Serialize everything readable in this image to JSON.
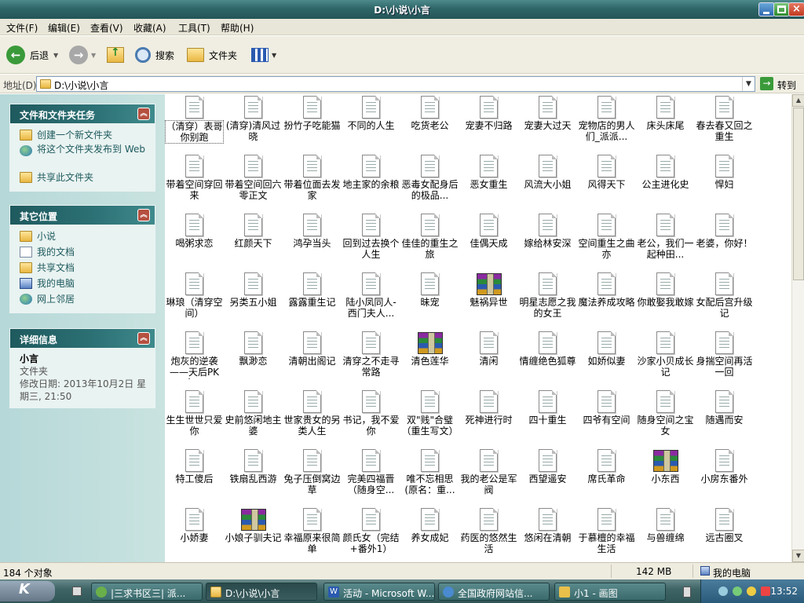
{
  "window": {
    "title": "D:\\小说\\小言"
  },
  "menu": [
    "文件(F)",
    "编辑(E)",
    "查看(V)",
    "收藏(A)",
    "工具(T)",
    "帮助(H)"
  ],
  "toolbar": {
    "back": "后退",
    "search": "搜索",
    "folders": "文件夹"
  },
  "address": {
    "label": "地址(D)",
    "value": "D:\\小说\\小言",
    "go": "转到"
  },
  "panels": {
    "tasks": {
      "title": "文件和文件夹任务",
      "items": [
        "创建一个新文件夹",
        "将这个文件夹发布到 Web",
        "共享此文件夹"
      ]
    },
    "places": {
      "title": "其它位置",
      "items": [
        "小说",
        "我的文档",
        "共享文档",
        "我的电脑",
        "网上邻居"
      ]
    },
    "details": {
      "title": "详细信息",
      "name": "小言",
      "type": "文件夹",
      "modified": "修改日期: 2013年10月2日 星期三, 21:50"
    }
  },
  "files": [
    {
      "name": "（清穿）表哥你别跑",
      "type": "txt"
    },
    {
      "name": "(清穿)清风过晓",
      "type": "txt"
    },
    {
      "name": "扮竹子吃能猫",
      "type": "txt"
    },
    {
      "name": "不同的人生",
      "type": "txt"
    },
    {
      "name": "吃货老公",
      "type": "txt"
    },
    {
      "name": "宠妻不归路",
      "type": "txt"
    },
    {
      "name": "宠妻大过天",
      "type": "txt"
    },
    {
      "name": "宠物店的男人们_派派...",
      "type": "txt"
    },
    {
      "name": "床头床尾",
      "type": "txt"
    },
    {
      "name": "春去春又回之重生",
      "type": "txt"
    },
    {
      "name": "带着空间穿回来",
      "type": "txt"
    },
    {
      "name": "带着空间回六零正文",
      "type": "txt"
    },
    {
      "name": "带着位面去发家",
      "type": "txt"
    },
    {
      "name": "地主家的余粮",
      "type": "txt"
    },
    {
      "name": "恶毒女配身后的极品...",
      "type": "txt"
    },
    {
      "name": "恶女重生",
      "type": "txt"
    },
    {
      "name": "风流大小姐",
      "type": "txt"
    },
    {
      "name": "风得天下",
      "type": "txt"
    },
    {
      "name": "公主进化史",
      "type": "txt"
    },
    {
      "name": "悍妇",
      "type": "txt"
    },
    {
      "name": "喝粥求恋",
      "type": "txt"
    },
    {
      "name": "红颜天下",
      "type": "txt"
    },
    {
      "name": "鸿孕当头",
      "type": "txt"
    },
    {
      "name": "回到过去换个人生",
      "type": "txt"
    },
    {
      "name": "佳佳的重生之旅",
      "type": "txt"
    },
    {
      "name": "佳偶天成",
      "type": "txt"
    },
    {
      "name": "嫁给林安深",
      "type": "txt"
    },
    {
      "name": "空间重生之曲亦",
      "type": "txt"
    },
    {
      "name": "老公，我们一起种田...",
      "type": "txt"
    },
    {
      "name": "老婆，你好！",
      "type": "txt"
    },
    {
      "name": "琳琅（清穿空间）",
      "type": "txt"
    },
    {
      "name": "另类五小姐",
      "type": "txt"
    },
    {
      "name": "露露重生记",
      "type": "txt"
    },
    {
      "name": "陆小凤同人-西门夫人...",
      "type": "txt"
    },
    {
      "name": "昧宠",
      "type": "txt"
    },
    {
      "name": "魅祸异世",
      "type": "rar"
    },
    {
      "name": "明星志愿之我的女王",
      "type": "txt"
    },
    {
      "name": "魔法养成攻略",
      "type": "txt"
    },
    {
      "name": "你敢娶我敢嫁",
      "type": "txt"
    },
    {
      "name": "女配后宫升级记",
      "type": "txt"
    },
    {
      "name": "炮灰的逆袭——天后PK女...",
      "type": "txt"
    },
    {
      "name": "飘渺恋",
      "type": "txt"
    },
    {
      "name": "清朝出阁记",
      "type": "txt"
    },
    {
      "name": "清穿之不走寻常路",
      "type": "txt"
    },
    {
      "name": "清色莲华",
      "type": "rar"
    },
    {
      "name": "清闲",
      "type": "txt"
    },
    {
      "name": "情缠绝色狐尊",
      "type": "txt"
    },
    {
      "name": "如娇似妻",
      "type": "txt"
    },
    {
      "name": "沙家小贝成长记",
      "type": "txt"
    },
    {
      "name": "身揣空间再活一回",
      "type": "txt"
    },
    {
      "name": "生生世世只爱你",
      "type": "txt"
    },
    {
      "name": "史前悠闲地主婆",
      "type": "txt"
    },
    {
      "name": "世家贵女的另类人生",
      "type": "txt"
    },
    {
      "name": "书记，我不爱你",
      "type": "txt"
    },
    {
      "name": "双\"贱\"合璧（重生写文）",
      "type": "txt"
    },
    {
      "name": "死神进行时",
      "type": "txt"
    },
    {
      "name": "四十重生",
      "type": "txt"
    },
    {
      "name": "四爷有空间",
      "type": "txt"
    },
    {
      "name": "随身空间之宝女",
      "type": "txt"
    },
    {
      "name": "随遇而安",
      "type": "txt"
    },
    {
      "name": "特工傻后",
      "type": "txt"
    },
    {
      "name": "铁扇乱西游",
      "type": "txt"
    },
    {
      "name": "兔子压倒窝边草",
      "type": "txt"
    },
    {
      "name": "完美四福晋（随身空...",
      "type": "txt"
    },
    {
      "name": "唯不忘相思(原名：重...",
      "type": "txt"
    },
    {
      "name": "我的老公是军阀",
      "type": "txt"
    },
    {
      "name": "西望遥安",
      "type": "txt"
    },
    {
      "name": "席氏革命",
      "type": "txt"
    },
    {
      "name": "小东西",
      "type": "rar"
    },
    {
      "name": "小房东番外",
      "type": "txt"
    },
    {
      "name": "小娇妻",
      "type": "txt"
    },
    {
      "name": "小娘子驯夫记",
      "type": "rar"
    },
    {
      "name": "幸福原来很简单",
      "type": "txt"
    },
    {
      "name": "颜氏女（完结+番外1）",
      "type": "txt"
    },
    {
      "name": "养女成妃",
      "type": "txt"
    },
    {
      "name": "药医的悠然生活",
      "type": "txt"
    },
    {
      "name": "悠闲在清朝",
      "type": "txt"
    },
    {
      "name": "于慕檀的幸福生活",
      "type": "txt"
    },
    {
      "name": "与兽缠绵",
      "type": "txt"
    },
    {
      "name": "远古圈叉",
      "type": "txt"
    }
  ],
  "status": {
    "count": "184 个对象",
    "size": "142 MB",
    "location": "我的电脑"
  },
  "taskbar": {
    "tasks": [
      "|三求书区三| 派...",
      "D:\\小说\\小言",
      "活动 - Microsoft W...",
      "全国政府网站信...",
      "小1 - 画图"
    ],
    "clock": "13:52"
  },
  "colors": {
    "title_bar": "#2f6668",
    "panel_head": "#1e5a5e",
    "side_bg": "#b6d8d8",
    "link": "#1e5a5e"
  }
}
